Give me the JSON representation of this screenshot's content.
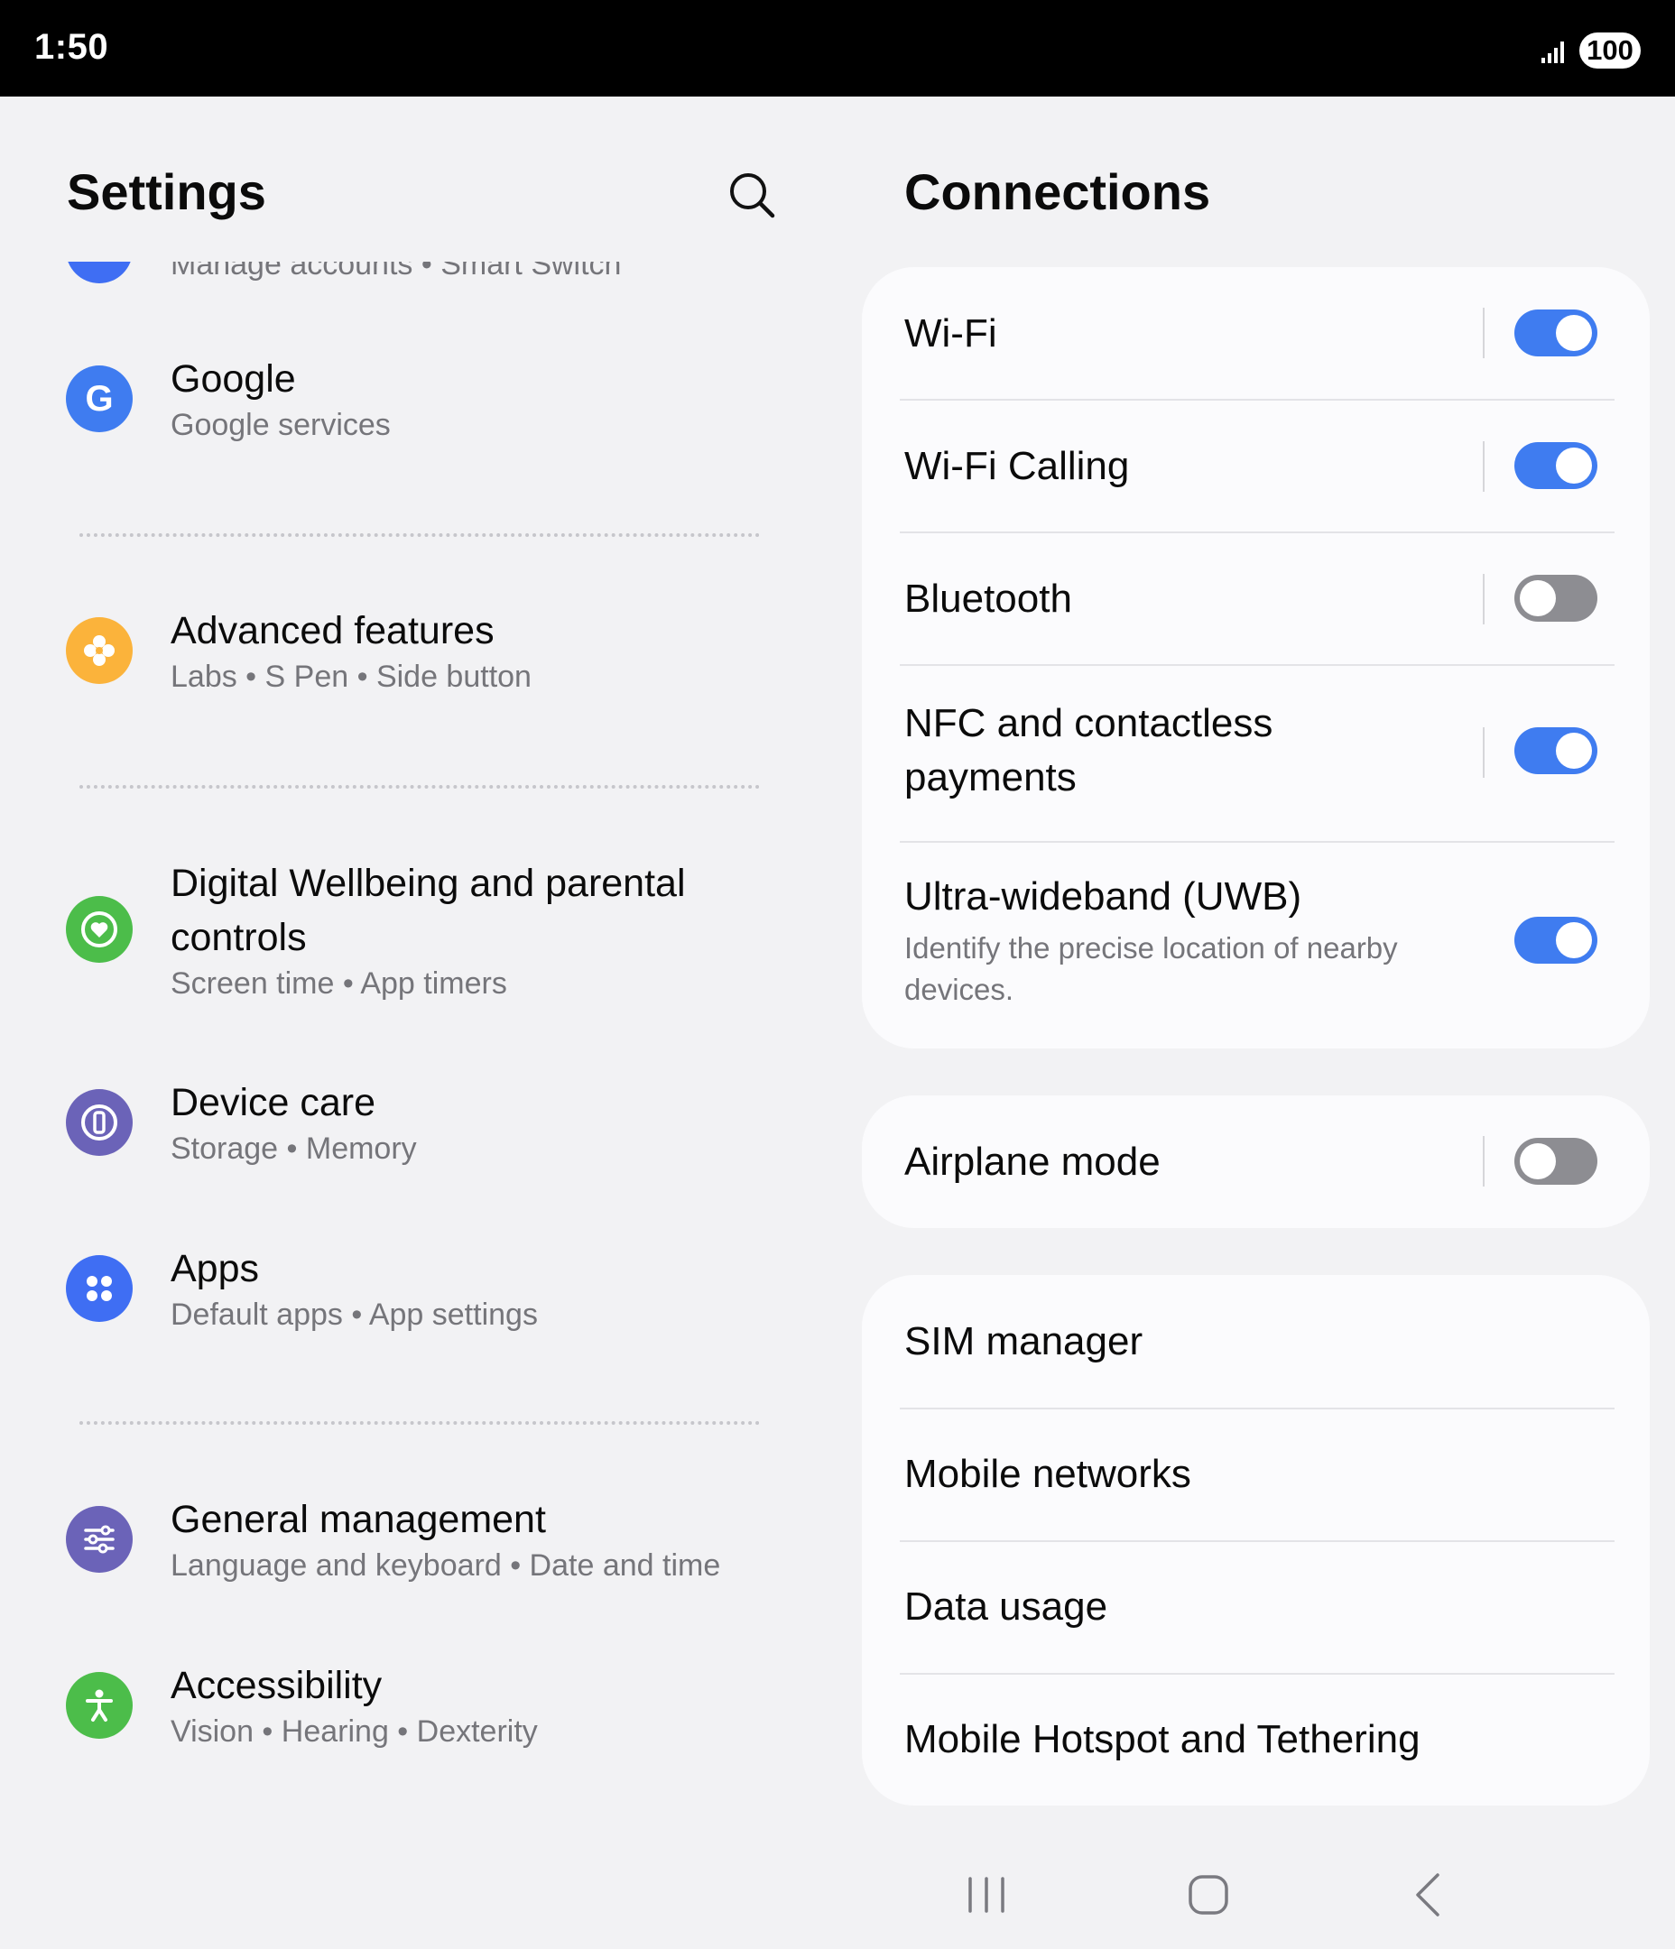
{
  "status_bar": {
    "time": "1:50",
    "battery": "100"
  },
  "left_panel": {
    "title": "Settings",
    "items": [
      {
        "title": "",
        "subtitle": "Manage accounts  •  Smart Switch",
        "icon": "accounts-icon",
        "color": "#3f6ef3"
      },
      {
        "title": "Google",
        "subtitle": "Google services",
        "icon": "google-icon",
        "color": "#3f7cf0"
      },
      {
        "title": "Advanced features",
        "subtitle": "Labs  •  S Pen  •  Side button",
        "icon": "advanced-features-icon",
        "color": "#fbb33b"
      },
      {
        "title": "Digital Wellbeing and parental controls",
        "subtitle": "Screen time  •  App timers",
        "icon": "digital-wellbeing-icon",
        "color": "#4cbd4a"
      },
      {
        "title": "Device care",
        "subtitle": "Storage  •  Memory",
        "icon": "device-care-icon",
        "color": "#6b63b8"
      },
      {
        "title": "Apps",
        "subtitle": "Default apps  •  App settings",
        "icon": "apps-icon",
        "color": "#3f6ef3"
      },
      {
        "title": "General management",
        "subtitle": "Language and keyboard  •  Date and time",
        "icon": "general-management-icon",
        "color": "#6b63b8"
      },
      {
        "title": "Accessibility",
        "subtitle": "Vision  •  Hearing  •  Dexterity",
        "icon": "accessibility-icon",
        "color": "#4cbd4a"
      }
    ]
  },
  "right_panel": {
    "title": "Connections",
    "wifi": {
      "label": "Wi-Fi",
      "enabled": true
    },
    "wifi_calling": {
      "label": "Wi-Fi Calling",
      "enabled": true
    },
    "bluetooth": {
      "label": "Bluetooth",
      "enabled": false
    },
    "nfc": {
      "label": "NFC and contactless payments",
      "enabled": true
    },
    "uwb": {
      "label": "Ultra-wideband (UWB)",
      "description": "Identify the precise location of nearby devices.",
      "enabled": true
    },
    "airplane": {
      "label": "Airplane mode",
      "enabled": false
    },
    "sim_manager": {
      "label": "SIM manager"
    },
    "mobile_networks": {
      "label": "Mobile networks"
    },
    "data_usage": {
      "label": "Data usage"
    },
    "hotspot": {
      "label": "Mobile Hotspot and Tethering"
    }
  },
  "colors": {
    "toggle_on": "#3f7cf0",
    "toggle_off": "#8d8d92",
    "background": "#f2f2f4",
    "card": "#fbfbfd"
  },
  "nav_bar": {
    "recents": "recents-icon",
    "home": "home-icon",
    "back": "back-icon"
  }
}
